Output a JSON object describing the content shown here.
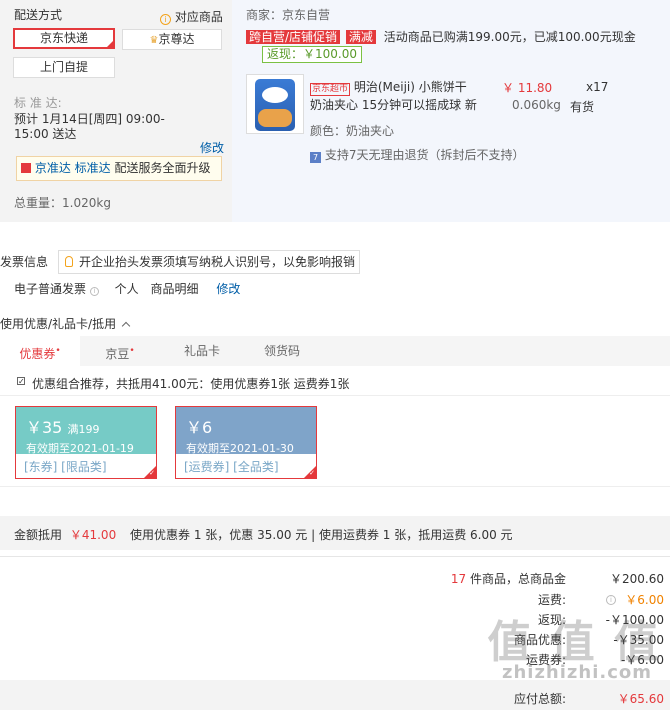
{
  "shipping": {
    "title": "配送方式",
    "corresponding_link": "对应商品",
    "options": [
      "京东快递",
      "京尊达",
      "上门自提"
    ],
    "standard_label": "标 准 达:",
    "estimate": "预计 1月14日[周四] 09:00-15:00 送达",
    "estimate_line1": "预计 1月14日[周四] 09:00-",
    "estimate_line2": "15:00 送达",
    "modify": "修改",
    "upgrade_tag": "京准达",
    "upgrade_tag2": "标准达",
    "upgrade_text": "配送服务全面升级",
    "weight_label": "总重量：",
    "weight_value": "1.020kg"
  },
  "order": {
    "merchant": "商家：京东自营",
    "promo_tag1": "跨自营/店铺促销",
    "promo_tag2": "满减",
    "promo_text": "活动商品已购满199.00元，已减100.00元现金",
    "rebate_tag": "返现：￥100.00",
    "jd_tag": "京东超市",
    "product_name_line1": "明治(Meiji) 小熊饼干",
    "product_name_line2": "奶油夹心 15分钟可以摇成球 新",
    "price": "￥ 11.80",
    "qty": "x17",
    "weight": "0.060kg",
    "stock": "有货",
    "color_label": "颜色：奶油夹心",
    "return_policy": "支持7天无理由退货（拆封后不支持）"
  },
  "invoice": {
    "title": "发票信息",
    "tip": "开企业抬头发票须填写纳税人识别号，以免影响报销",
    "type": "电子普通发票",
    "owner": "个人",
    "content": "商品明细",
    "modify": "修改"
  },
  "discount": {
    "title": "使用优惠/礼品卡/抵用",
    "tabs": [
      "优惠券",
      "京豆",
      "礼品卡",
      "领货码"
    ],
    "recommend": "优惠组合推荐，共抵用41.00元：使用优惠券1张 运费券1张",
    "coupons": [
      {
        "amount": "￥35",
        "cond": "满199",
        "expiry": "有效期至2021-01-19",
        "tags": "[东券] [限品类]",
        "color": "#76cbc6"
      },
      {
        "amount": "￥6",
        "cond": "",
        "expiry": "有效期至2021-01-30",
        "tags": "[运费券] [全品类]",
        "color": "#7fa4c9"
      }
    ],
    "summary_label": "金额抵用",
    "summary_amount": "￥41.00",
    "summary_text": "使用优惠券 1 张，优惠 35.00 元 | 使用运费券 1 张，抵用运费 6.00 元"
  },
  "totals": {
    "count": "17",
    "count_text": "件商品，总商品金",
    "goods_amount": "￥200.60",
    "shipping_label": "运费:",
    "shipping_value": "￥6.00",
    "rebate_label": "返现:",
    "rebate_value": "-￥100.00",
    "coupon_label": "商品优惠:",
    "coupon_value": "-￥35.00",
    "freight_coupon_label": "运费券:",
    "freight_coupon_value": "-￥6.00",
    "payable_label": "应付总额:",
    "payable_value": "￥65.60"
  },
  "watermark": {
    "text": "值 值 值",
    "url": "zhizhizhi.com"
  },
  "colors": {
    "accent": "#e4393c",
    "link": "#005ea7",
    "panel": "#f3f3f3",
    "panel_blue": "#f3f6fc"
  }
}
